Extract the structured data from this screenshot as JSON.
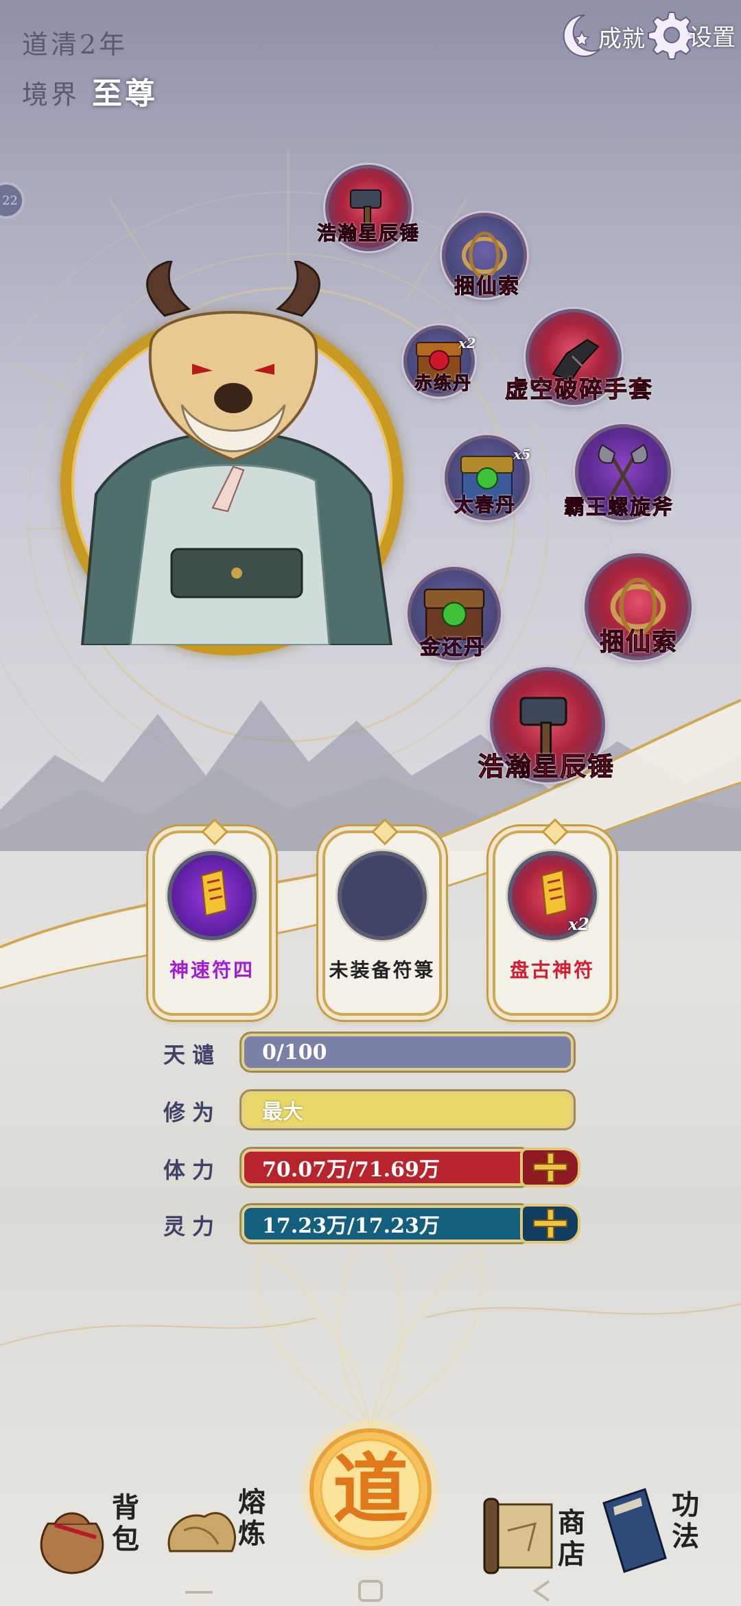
{
  "header": {
    "year_label": "道清2年",
    "realm_label": "境界",
    "realm_value": "至尊",
    "achievement_label": "成就",
    "settings_label": "设置",
    "side_badge": "22"
  },
  "equipment": [
    {
      "name": "浩瀚星辰锤",
      "icon": "hammer-icon",
      "style": "red"
    },
    {
      "name": "捆仙索",
      "icon": "rope-icon",
      "style": "blue"
    },
    {
      "name": "赤练丹",
      "icon": "chest-red-orb-icon",
      "style": "blue",
      "count": "x2"
    },
    {
      "name": "虚空破碎手套",
      "icon": "gauntlet-icon",
      "style": "red"
    },
    {
      "name": "太春丹",
      "icon": "chest-green-orb-icon",
      "style": "blue",
      "count": "x5"
    },
    {
      "name": "霸王螺旋斧",
      "icon": "axe-icon",
      "style": "purple"
    },
    {
      "name": "金还丹",
      "icon": "chest-green-orb-icon",
      "style": "blue"
    },
    {
      "name": "捆仙索",
      "icon": "rope-icon",
      "style": "red"
    },
    {
      "name": "浩瀚星辰锤",
      "icon": "hammer-icon",
      "style": "red"
    }
  ],
  "talismans": [
    {
      "label": "神速符四",
      "color": "#a51ad6",
      "icon": "talisman-icon"
    },
    {
      "label": "未装备符箓",
      "color": "#222222",
      "icon": ""
    },
    {
      "label": "盘古神符",
      "color": "#d81a2e",
      "icon": "talisman-icon",
      "count": "x2"
    }
  ],
  "stats": {
    "tianqian": {
      "name": "天谴",
      "value": "0/100",
      "color": "#7b80a6"
    },
    "xiuwei": {
      "name": "修为",
      "value": "最大",
      "color": "#e9d869"
    },
    "tili": {
      "name": "体力",
      "value": "70.07万/71.69万",
      "color": "#b8242c"
    },
    "lingli": {
      "name": "灵力",
      "value": "17.23万/17.23万",
      "color": "#145e7e"
    }
  },
  "nav": {
    "bag": "背包",
    "smelt": "熔炼",
    "dao": "道",
    "shop": "商店",
    "skills": "功法"
  }
}
